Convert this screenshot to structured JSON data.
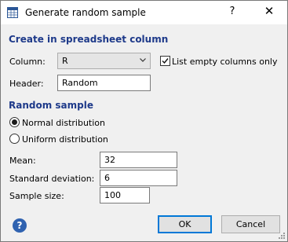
{
  "window": {
    "title": "Generate random sample",
    "help_glyph": "?",
    "close_glyph": "✕"
  },
  "spreadsheet_section": {
    "heading": "Create in spreadsheet column",
    "column_label": "Column:",
    "column_value": "R",
    "empty_only_label": "List empty columns only",
    "empty_only_checked": true,
    "header_label": "Header:",
    "header_value": "Random"
  },
  "sample_section": {
    "heading": "Random sample",
    "distributions": [
      {
        "label": "Normal distribution",
        "selected": true
      },
      {
        "label": "Uniform distribution",
        "selected": false
      }
    ]
  },
  "params": {
    "mean_label": "Mean:",
    "mean_value": "32",
    "sd_label": "Standard deviation:",
    "sd_value": "6",
    "size_label": "Sample size:",
    "size_value": "100"
  },
  "footer": {
    "ok_label": "OK",
    "cancel_label": "Cancel",
    "help_glyph": "?"
  },
  "colors": {
    "accent": "#0078d7",
    "heading": "#1e3a8a",
    "help_icon": "#2f62b0"
  }
}
